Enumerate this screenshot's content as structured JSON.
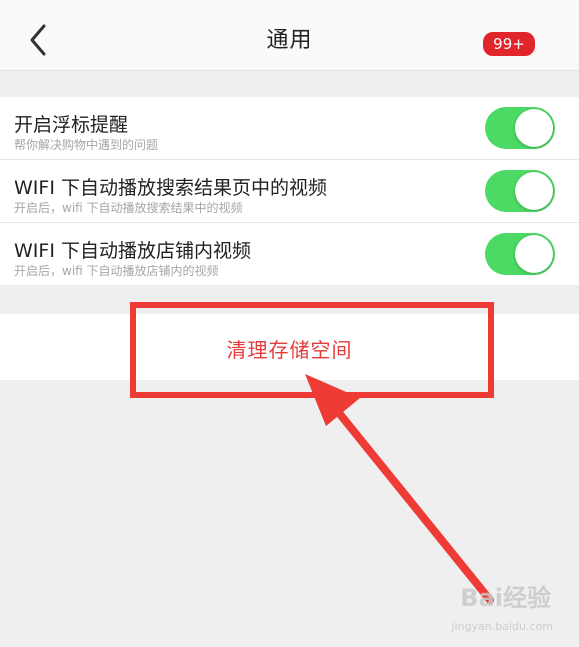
{
  "header": {
    "title": "通用",
    "badge": "99+",
    "back_icon": "chevron-left-icon",
    "more_icon": "more-dots-icon"
  },
  "settings": {
    "items": [
      {
        "title": "开启浮标提醒",
        "subtitle": "帮你解决购物中遇到的问题",
        "enabled": true
      },
      {
        "title": "WIFI 下自动播放搜索结果页中的视频",
        "subtitle": "开启后，wifi 下自动播放搜索结果中的视频",
        "enabled": true
      },
      {
        "title": "WIFI 下自动播放店铺内视频",
        "subtitle": "开启后，wifi 下自动播放店铺内的视频",
        "enabled": true
      }
    ]
  },
  "clear_storage": {
    "label": "清理存储空间"
  },
  "watermark": {
    "text": "Bai经验",
    "sub": "jingyan.baidu.com"
  },
  "colors": {
    "toggle_on": "#4cd964",
    "accent_red": "#e43c3c",
    "annotation_red": "#ee3b36",
    "badge_red": "#e0252b"
  }
}
